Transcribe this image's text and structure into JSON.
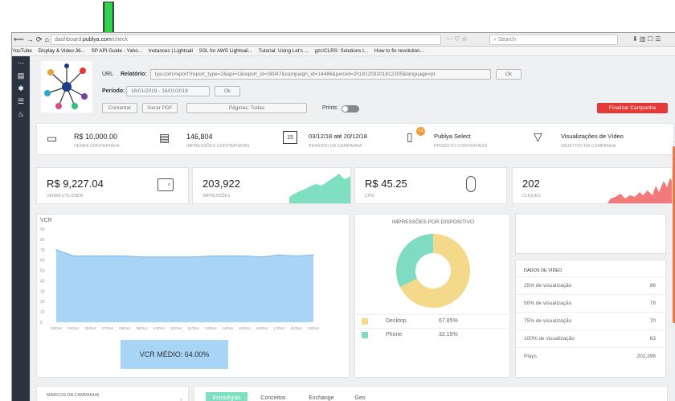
{
  "browser": {
    "url_prefix": "dashboard.",
    "url_domain": "publya.com",
    "url_path": "/check",
    "search_placeholder": "Search",
    "bookmarks": [
      "YouTube",
      "Display & Video 36...",
      "SP API Guide - Yaho...",
      "Instances | Lightsail",
      "SSL for AWS Lightsail...",
      "Tutorial: Using Let's ...",
      "gzc/CLRS: Solutions t...",
      "How to fix revolution..."
    ]
  },
  "header": {
    "url_label": "URL",
    "relatorio_label": "Relatório:",
    "report_url": "lya.com/report?report_type=2&api=1&report_id=38047&campaign_id=14486&period=20181203201812205&language=pt",
    "ok_label": "Ok",
    "periodo_label": "Período:",
    "period_value": "16/01/2019 - 16/01/2019",
    "ok2_label": "Ok",
    "comentar_label": "Comentar",
    "gerar_pdf_label": "Gerar PDF",
    "paginas_label": "Páginas: Todas",
    "prints_label": "Prints:",
    "finalizar_label": "Finalizar Campanha"
  },
  "kpis": [
    {
      "value": "R$ 10,000.00",
      "label": "VERBA CONTRATADA",
      "icon": "money-icon"
    },
    {
      "value": "146,804",
      "label": "IMPRESSÕES CONTRATADAS",
      "icon": "monitor-icon"
    },
    {
      "value": "03/12/18 até 20/12/18",
      "label": "PERÍODO DA CAMPANHA",
      "icon": "calendar-icon",
      "icon_text": "15"
    },
    {
      "value": "Publya Select",
      "label": "PRODUTO CONTRATADO",
      "icon": "clipboard-icon",
      "badge": "+1"
    },
    {
      "value": "Visualizações de Vídeo",
      "label": "OBJETIVO DA CAMPANHA",
      "icon": "cup-icon"
    }
  ],
  "stats": [
    {
      "value": "R$ 9,227.04",
      "label": "VERBA UTILIZADA",
      "icon": "wallet-icon"
    },
    {
      "value": "203,922",
      "label": "IMPRESSÕES",
      "sparkline": "teal"
    },
    {
      "value": "R$ 45.25",
      "label": "CPM",
      "icon": "mouse-icon"
    },
    {
      "value": "202",
      "label": "CLIQUES",
      "sparkline": "red"
    }
  ],
  "colors": {
    "teal": "#7ee0c0",
    "red": "#f27a7a",
    "vcr_fill": "#a8d4f5",
    "desktop": "#f5d98a",
    "phone": "#7fdcc2",
    "accent_red": "#e53935",
    "sidebar": "#2a3340"
  },
  "vcr": {
    "title": "VCR",
    "avg_label": "VCR MÉDIO: 64.00%"
  },
  "chart_data": [
    {
      "type": "area",
      "title": "VCR",
      "x": [
        "04/Dez",
        "05/Dez",
        "06/Dez",
        "07/Dez",
        "08/Dez",
        "09/Dez",
        "10/Dez",
        "11/Dez",
        "12/Dez",
        "13/Dez",
        "14/Dez",
        "15/Dez",
        "16/Dez",
        "17/Dez",
        "18/Dez",
        "19/Dez"
      ],
      "series": [
        {
          "values": [
            70,
            64,
            64,
            64,
            64,
            63,
            63,
            63,
            63,
            64,
            64,
            64,
            63,
            65,
            64,
            65
          ]
        }
      ],
      "yticks": [
        0,
        10,
        20,
        30,
        40,
        50,
        60,
        70,
        80,
        90
      ],
      "ylim": [
        0,
        90
      ]
    },
    {
      "type": "pie",
      "title": "IMPRESSÕES POR DISPOSITIVO",
      "categories": [
        "Desktop",
        "Phone"
      ],
      "values": [
        67.85,
        32.15
      ],
      "labels": [
        "67.85%",
        "32.15%"
      ]
    }
  ],
  "video_data": {
    "title": "DADOS DE VÍDEO",
    "rows": [
      {
        "name": "25% de visualização",
        "value": "86"
      },
      {
        "name": "50% de visualização",
        "value": "78"
      },
      {
        "name": "75% de visualização",
        "value": "70"
      },
      {
        "name": "100% de visualização",
        "value": "63"
      },
      {
        "name": "Plays",
        "value": "202,396"
      }
    ]
  },
  "footer": {
    "marcos_label": "MARCOS DA CAMPANHA",
    "tabs": [
      "Estratégias",
      "Conceitos",
      "Exchange",
      "Geo"
    ]
  }
}
